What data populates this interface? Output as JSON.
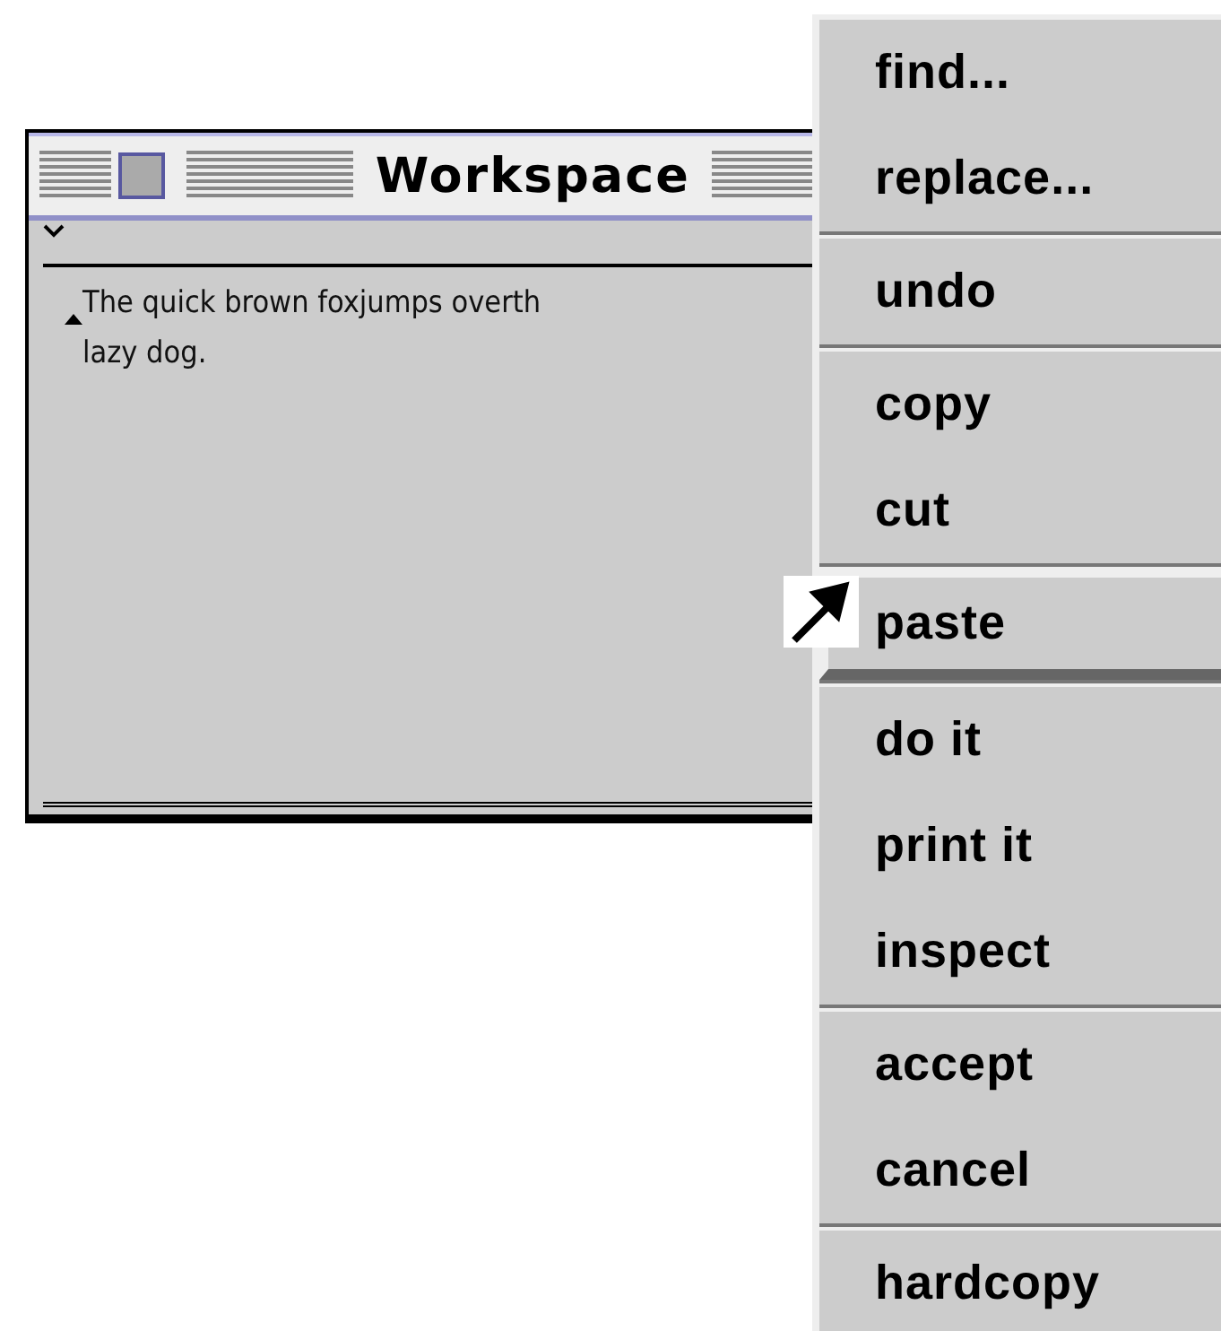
{
  "window": {
    "title": "Workspace",
    "text_lines": [
      "The quick brown foxjumps overth",
      "lazy dog."
    ]
  },
  "menu": {
    "groups": [
      {
        "items": [
          {
            "label": "find...",
            "selected": false
          },
          {
            "label": "replace...",
            "selected": false
          }
        ]
      },
      {
        "items": [
          {
            "label": "undo",
            "selected": false
          }
        ]
      },
      {
        "items": [
          {
            "label": "copy",
            "selected": false
          },
          {
            "label": "cut",
            "selected": false
          }
        ]
      },
      {
        "items": [
          {
            "label": "paste",
            "selected": true
          }
        ]
      },
      {
        "items": [
          {
            "label": "do it",
            "selected": false
          },
          {
            "label": "print it",
            "selected": false
          },
          {
            "label": "inspect",
            "selected": false
          }
        ]
      },
      {
        "items": [
          {
            "label": "accept",
            "selected": false
          },
          {
            "label": "cancel",
            "selected": false
          }
        ]
      },
      {
        "items": [
          {
            "label": "hardcopy",
            "selected": false
          }
        ]
      }
    ]
  }
}
